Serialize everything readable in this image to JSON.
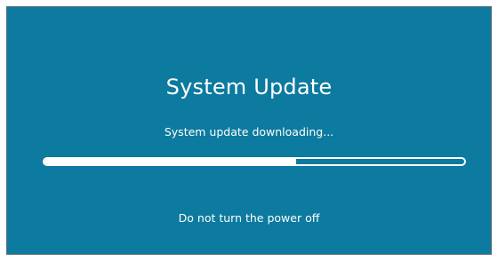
{
  "update": {
    "title": "System Update",
    "status_text": "System update downloading...",
    "progress_fraction": 0.6,
    "warning_text": "Do not turn the power off"
  },
  "colors": {
    "background": "#0d7a9f",
    "text": "#ffffff",
    "progress": "#ffffff"
  }
}
